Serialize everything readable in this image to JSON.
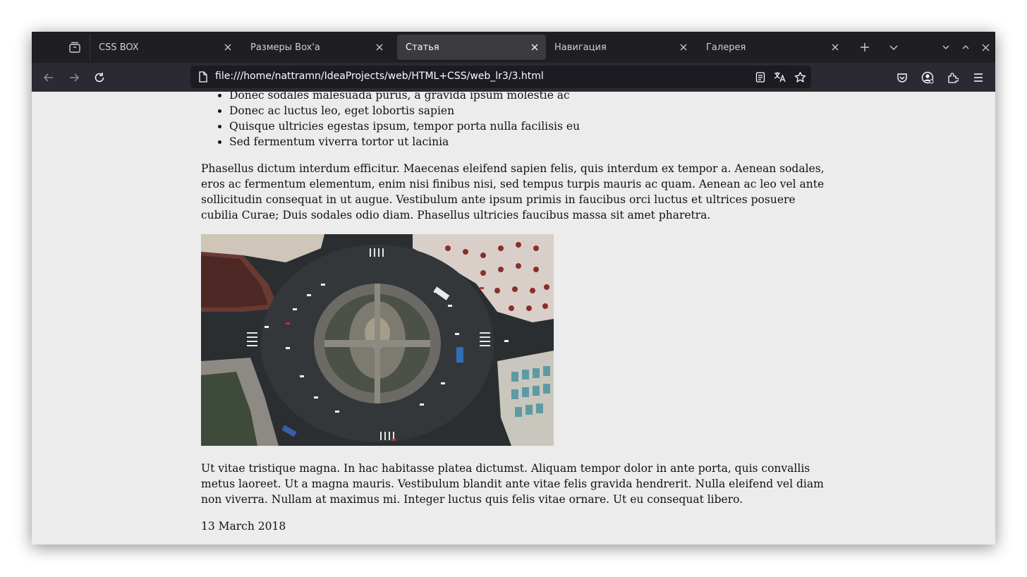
{
  "tabs": [
    {
      "title": "CSS BOX",
      "active": false
    },
    {
      "title": "Размеры Box'a",
      "active": false
    },
    {
      "title": "Статья",
      "active": true
    },
    {
      "title": "Навигация",
      "active": false
    },
    {
      "title": "Галерея",
      "active": false
    }
  ],
  "navbar": {
    "url": "file:///home/nattramn/IdeaProjects/web/HTML+CSS/web_lr3/3.html"
  },
  "article": {
    "list_items": [
      "Donec sodales malesuada purus, a gravida ipsum molestie ac",
      "Donec ac luctus leo, eget lobortis sapien",
      "Quisque ultricies egestas ipsum, tempor porta nulla facilisis eu",
      "Sed fermentum viverra tortor ut lacinia"
    ],
    "paragraph_1": "Phasellus dictum interdum efficitur. Maecenas eleifend sapien felis, quis interdum ex tempor a. Aenean sodales, eros ac fermentum elementum, enim nisi finibus nisi, sed tempus turpis mauris ac quam. Aenean ac leo vel ante sollicitudin consequat in ut augue. Vestibulum ante ipsum primis in faucibus orci luctus et ultrices posuere cubilia Curae; Duis sodales odio diam. Phasellus ultricies faucibus massa sit amet pharetra.",
    "paragraph_2": "Ut vitae tristique magna. In hac habitasse platea dictumst. Aliquam tempor dolor in ante porta, quis convallis metus laoreet. Ut a magna mauris. Vestibulum blandit ante vitae felis gravida hendrerit. Nulla eleifend vel diam non viverra. Nullam at maximus mi. Integer luctus quis felis vitae ornare. Ut eu consequat libero.",
    "date": "13 March 2018"
  },
  "colors": {
    "tabstrip_bg": "#1f1e22",
    "navbar_bg": "#2b2a33",
    "urlbar_bg": "#1c1b22",
    "page_bg": "#ececec"
  }
}
